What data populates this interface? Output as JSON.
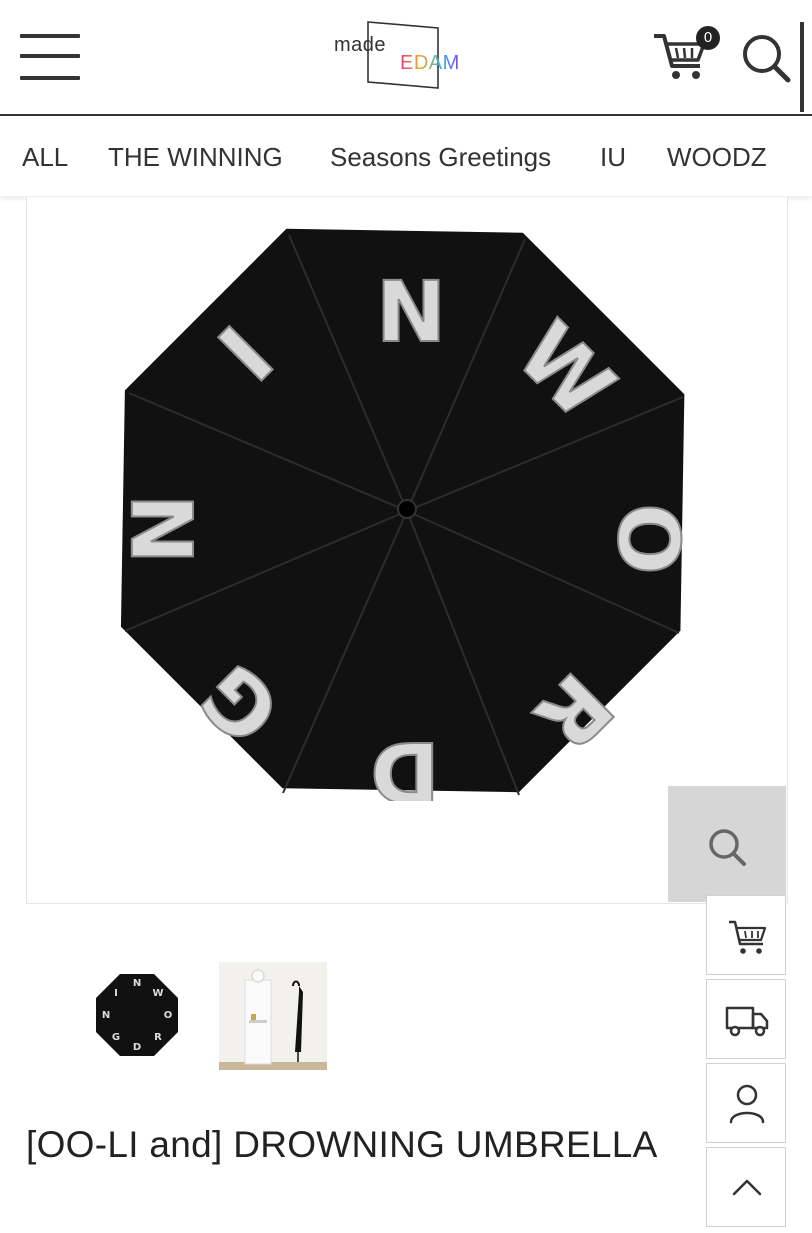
{
  "header": {
    "logo_top": "made",
    "logo_bottom": "EDAM",
    "cart_count": "0",
    "icons": {
      "menu": "hamburger-menu-icon",
      "cart": "cart-icon",
      "search": "search-icon"
    }
  },
  "nav": {
    "items": [
      {
        "label": "ALL"
      },
      {
        "label": "THE WINNING"
      },
      {
        "label": "Seasons Greetings"
      },
      {
        "label": "IU"
      },
      {
        "label": "WOODZ"
      }
    ]
  },
  "product": {
    "title": "[OO-LI and] DROWNING UMBRELLA",
    "umbrella_letters": [
      "N",
      "W",
      "O",
      "R",
      "D",
      "G",
      "N",
      "I"
    ],
    "thumbnails": [
      {
        "name": "thumbnail-umbrella-top"
      },
      {
        "name": "thumbnail-umbrella-stand"
      }
    ]
  },
  "side_buttons": [
    {
      "icon": "cart-icon"
    },
    {
      "icon": "truck-icon"
    },
    {
      "icon": "user-icon"
    },
    {
      "icon": "chevron-up-icon"
    }
  ],
  "colors": {
    "accent": "#222222",
    "zoom_bg": "#d6d6d6",
    "umbrella": "#111111",
    "letters": "#d9d9d9"
  }
}
